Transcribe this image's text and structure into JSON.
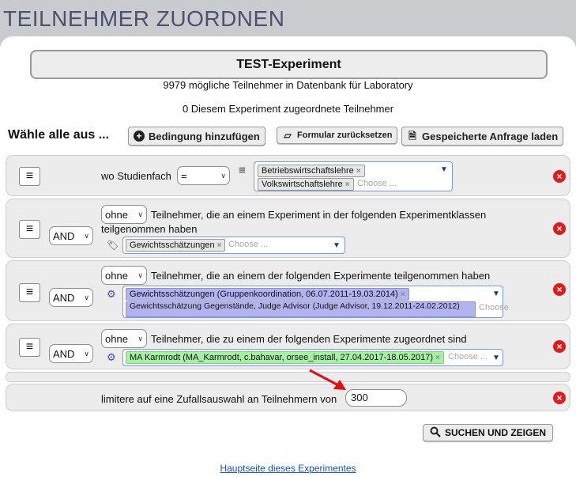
{
  "page_title": "TEILNEHMER ZUORDNEN",
  "experiment_title": "TEST-Experiment",
  "info_possible": "9979 mögliche Teilnehmer in Datenbank für Laboratory",
  "info_assigned": "0 Diesem Experiment zugeordnete Teilnehmer",
  "toolbar": {
    "select_all": "Wähle alle aus ...",
    "add_condition": "Bedingung hinzufügen",
    "reset_form": "Formular zurücksetzen",
    "load_query": "Gespeicherte Anfrage laden"
  },
  "conditions": [
    {
      "prefix": "wo Studienfach",
      "operator": "=",
      "tags": [
        "Betriebswirtschaftslehre",
        "Volkswirtschaftslehre"
      ],
      "placeholder": "Choose ..."
    },
    {
      "logic": "AND",
      "modifier": "ohne",
      "text": "Teilnehmer, die an einem Experiment in der folgenden Experimentklassen teilgenommen haben",
      "tags": [
        "Gewichtsschätzungen"
      ],
      "placeholder": "Choose ..."
    },
    {
      "logic": "AND",
      "modifier": "ohne",
      "text": "Teilnehmer, die an einem der folgenden Experimente teilgenommen haben",
      "tags": [
        "Gewichtsschätzungen (Gruppenkoordination, 06.07.2011-19.03.2014)",
        "Gewichtsschätzung Gegenstände, Judge Advisor (Judge Advisor, 19.12.2011-24.02.2012)"
      ],
      "placeholder": "Choose"
    },
    {
      "logic": "AND",
      "modifier": "ohne",
      "text": "Teilnehmer, die zu einem der folgenden Experimente zugeordnet sind",
      "tags": [
        "MA Karmrodt (MA_Karmrodt, c.bahavar, orsee_install, 27.04.2017-18.05.2017)"
      ],
      "placeholder": "Choose ..."
    }
  ],
  "limit": {
    "label": "limitere auf eine Zufallsauswahl an Teilnehmern von",
    "value": "300"
  },
  "search_button": "SUCHEN UND ZEIGEN",
  "footer_link": "Hauptseite dieses Experimentes",
  "icons": {
    "delete": "x-circle-icon",
    "menu": "hamburger-icon",
    "search": "search-icon",
    "gear": "gear-icon",
    "tag": "tag-icon"
  },
  "colors": {
    "delete_red": "#e21a1a",
    "tag_purple": "#b3b3f0",
    "tag_green": "#a6f0a6",
    "link_blue": "#1a4fb3",
    "arrow_red": "#e01010"
  }
}
